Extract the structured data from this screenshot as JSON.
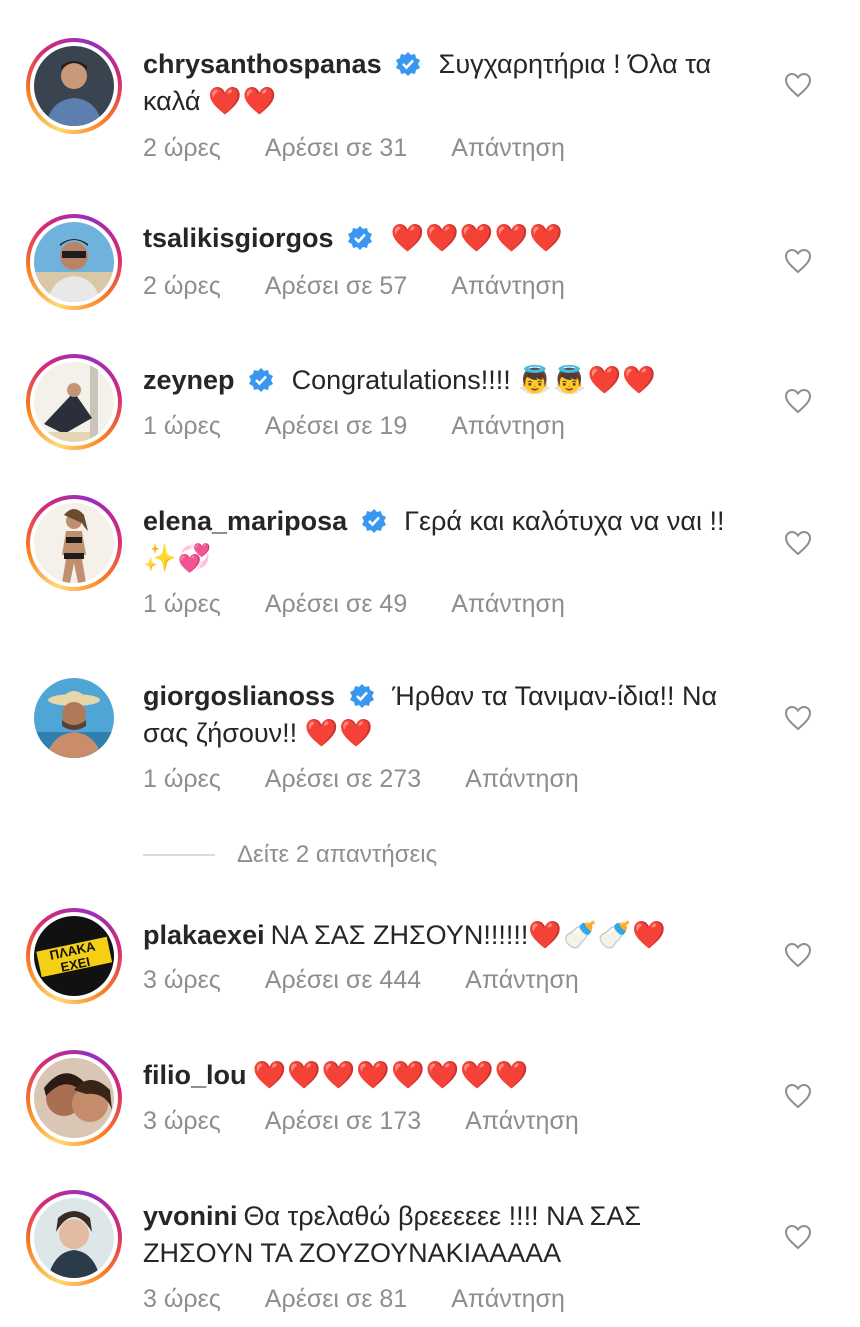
{
  "comments": [
    {
      "username": "chrysanthospanas",
      "verified": true,
      "text": "Συγχαρητήρια ! Όλα τα καλά ",
      "emoji": "❤️❤️",
      "time": "2 ώρες",
      "likes": "Αρέσει σε 31",
      "reply": "Απάντηση"
    },
    {
      "username": "tsalikisgiorgos",
      "verified": true,
      "text": "",
      "emoji": "❤️❤️❤️❤️❤️",
      "time": "2 ώρες",
      "likes": "Αρέσει σε 57",
      "reply": "Απάντηση"
    },
    {
      "username": "zeynep",
      "verified": true,
      "text": "Congratulations!!!! ",
      "emoji": "👼👼❤️❤️",
      "time": "1 ώρες",
      "likes": "Αρέσει σε 19",
      "reply": "Απάντηση"
    },
    {
      "username": "elena_mariposa",
      "verified": true,
      "text": "Γερά και καλότυχα να ναι !! ",
      "emoji": "✨💞",
      "time": "1 ώρες",
      "likes": "Αρέσει σε 49",
      "reply": "Απάντηση"
    },
    {
      "username": "giorgoslianoss",
      "verified": true,
      "text": "Ήρθαν τα Τανιμαν-ίδια!! Να σας ζήσουν!! ",
      "emoji": "❤️❤️",
      "time": "1 ώρες",
      "likes": "Αρέσει σε 273",
      "reply": "Απάντηση"
    },
    {
      "username": "plakaexei",
      "verified": false,
      "text": "ΝΑ ΣΑΣ ΖΗΣΟΥΝ!!!!!!",
      "emoji": "❤️🍼🍼❤️",
      "time": "3 ώρες",
      "likes": "Αρέσει σε 444",
      "reply": "Απάντηση"
    },
    {
      "username": "filio_lou",
      "verified": false,
      "text": "",
      "emoji": "❤️❤️❤️❤️❤️❤️❤️❤️",
      "time": "3 ώρες",
      "likes": "Αρέσει σε 173",
      "reply": "Απάντηση"
    },
    {
      "username": "yvonini",
      "verified": false,
      "text": "Θα τρελαθώ βρεεεεεε !!!! ΝΑ ΣΑΣ ΖΗΣΟΥΝ ΤΑ ΖΟΥΖΟΥΝΑΚΙΑΑΑΑΑ",
      "emoji": "",
      "time": "3 ώρες",
      "likes": "Αρέσει σε 81",
      "reply": "Απάντηση"
    }
  ],
  "view_replies": "Δείτε 2 απαντήσεις",
  "avatar_logo_text": "ΠΛΑΚΑ ΕΧΕΙ",
  "colors": {
    "verified": "#3897f0",
    "meta": "#8e8e8e",
    "heart": "#e0152b"
  }
}
